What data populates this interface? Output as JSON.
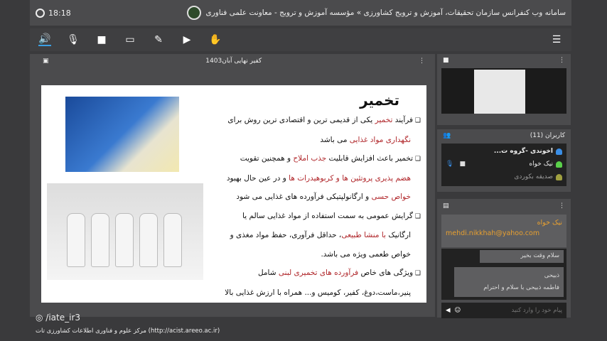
{
  "header": {
    "title": "سامانه وب کنفرانس سازمان تحقیقات، آموزش و ترویج کشاورزی » مؤسسه آموزش و ترویج - معاونت علمی فناوری",
    "time": "18:18"
  },
  "toolbar": {
    "icons": [
      "speaker-icon",
      "mic-muted-icon",
      "camera-icon",
      "screen-share-icon",
      "brush-icon",
      "presentation-icon",
      "raise-hand-icon"
    ],
    "menu": "☰"
  },
  "presentation": {
    "file_name": "کفیر نهایی آبان1403"
  },
  "slide": {
    "title": "تخمیر",
    "lines": [
      [
        {
          "t": "فرآیند "
        },
        {
          "t": "تخمیر",
          "red": 1
        },
        {
          "t": " یکی از قدیمی ترین و اقتصادی ترین روش برای"
        }
      ],
      [
        {
          "t": "نگهداری مواد غذایی",
          "red": 1
        },
        {
          "t": " می باشد"
        }
      ],
      [
        {
          "t": "تخمیر باعث افزایش قابلیت "
        },
        {
          "t": "جذب املاح",
          "red": 1
        },
        {
          "t": " و همچنین تقویت"
        }
      ],
      [
        {
          "t": "هضم پذیری پروتئین ها و کربوهیدرات ها",
          "red": 1
        },
        {
          "t": " و در عین حال بهبود"
        }
      ],
      [
        {
          "t": "خواص حسی",
          "red": 1
        },
        {
          "t": " و ارگانولپتیکی فرآورده های غذایی می شود"
        }
      ],
      [
        {
          "t": "گرایش عمومی به سمت استفاده از مواد غذایی سالم یا"
        }
      ],
      [
        {
          "t": "ارگانیک "
        },
        {
          "t": "با منشا طبیعی",
          "red": 1
        },
        {
          "t": "، حداقل فرآوری، حفظ مواد مغذی و"
        }
      ],
      [
        {
          "t": "خواص طعمی ویژه می باشد."
        }
      ],
      [
        {
          "t": "ویژگی های خاص "
        },
        {
          "t": "فرآورده های تخمیری لبنی",
          "red": 1
        },
        {
          "t": " شامل"
        }
      ],
      [
        {
          "t": "پنیر،ماست،دوغ، کفیر، کومیس و... همراه با ارزش غذایی بالا"
        }
      ]
    ],
    "bullets": [
      0,
      2,
      5,
      8
    ]
  },
  "users": {
    "title": "کاربران (11)",
    "list": [
      {
        "name": "اخوندی -گروه ت...",
        "color": "#3a8ee6",
        "bold": true
      },
      {
        "name": "نیک خواه",
        "color": "#5ad04a"
      },
      {
        "name": "صدیقه بکوردی",
        "color": "#a0a040",
        "dim": true
      }
    ]
  },
  "chat": {
    "sender": "نیک خواه",
    "email": "mehdi.nikkhah@yahoo.com",
    "messages": [
      {
        "text": "سلام وقت بخیر"
      },
      {
        "author": "ذبیحی",
        "text": "فاطمه ذبیحی  با سلام و احترام"
      }
    ],
    "placeholder": "پیام خود را وارد کنید"
  },
  "footer": {
    "handle": "/iate_ir3",
    "org": "مرکز علوم و فناوری اطلاعات کشاورزی تات (http://acist.areeo.ac.ir)"
  }
}
